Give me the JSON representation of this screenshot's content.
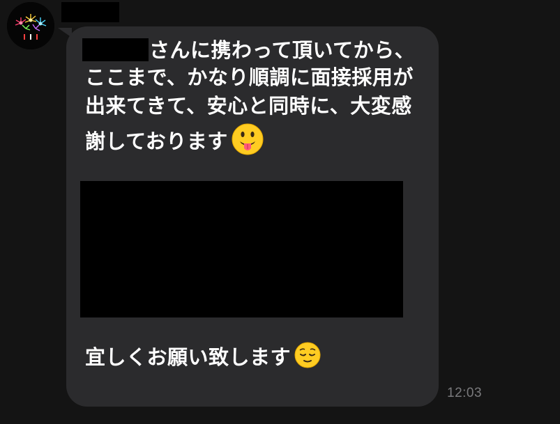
{
  "conversation": {
    "sender": {
      "avatar_icon": "fireworks-avatar-icon",
      "name_redacted": true
    },
    "message": {
      "lines": [
        "さんに携わって頂いてから、",
        "ここまで、かなり順調に面接採用が",
        "出来てきて、安心と同時に、大変感",
        "謝しております"
      ],
      "closing": "宜しくお願い致します",
      "emoji_1": "face-with-tongue-icon",
      "emoji_2": "relieved-face-icon",
      "timestamp": "12:03"
    }
  },
  "colors": {
    "background": "#141414",
    "bubble": "#2b2b2d",
    "text": "#ffffff",
    "timestamp": "#7a7a7d",
    "redaction": "#000000"
  }
}
